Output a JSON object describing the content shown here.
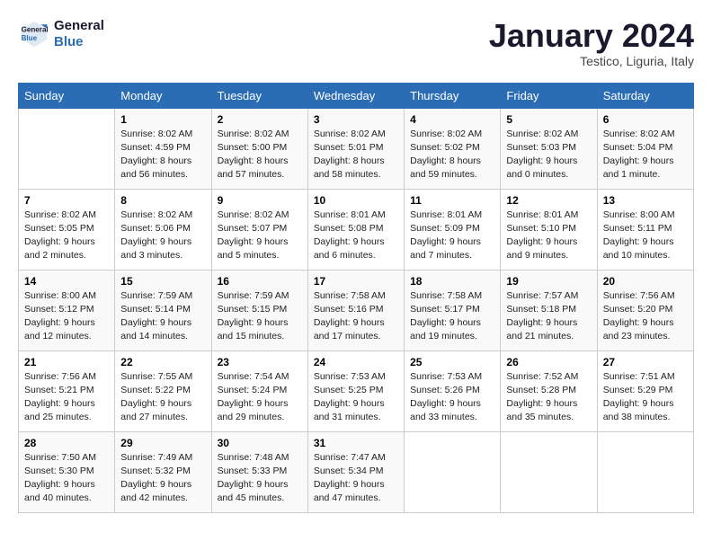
{
  "logo": {
    "line1": "General",
    "line2": "Blue"
  },
  "title": "January 2024",
  "subtitle": "Testico, Liguria, Italy",
  "days_of_week": [
    "Sunday",
    "Monday",
    "Tuesday",
    "Wednesday",
    "Thursday",
    "Friday",
    "Saturday"
  ],
  "weeks": [
    [
      {
        "day": "",
        "info": ""
      },
      {
        "day": "1",
        "info": "Sunrise: 8:02 AM\nSunset: 4:59 PM\nDaylight: 8 hours\nand 56 minutes."
      },
      {
        "day": "2",
        "info": "Sunrise: 8:02 AM\nSunset: 5:00 PM\nDaylight: 8 hours\nand 57 minutes."
      },
      {
        "day": "3",
        "info": "Sunrise: 8:02 AM\nSunset: 5:01 PM\nDaylight: 8 hours\nand 58 minutes."
      },
      {
        "day": "4",
        "info": "Sunrise: 8:02 AM\nSunset: 5:02 PM\nDaylight: 8 hours\nand 59 minutes."
      },
      {
        "day": "5",
        "info": "Sunrise: 8:02 AM\nSunset: 5:03 PM\nDaylight: 9 hours\nand 0 minutes."
      },
      {
        "day": "6",
        "info": "Sunrise: 8:02 AM\nSunset: 5:04 PM\nDaylight: 9 hours\nand 1 minute."
      }
    ],
    [
      {
        "day": "7",
        "info": "Sunrise: 8:02 AM\nSunset: 5:05 PM\nDaylight: 9 hours\nand 2 minutes."
      },
      {
        "day": "8",
        "info": "Sunrise: 8:02 AM\nSunset: 5:06 PM\nDaylight: 9 hours\nand 3 minutes."
      },
      {
        "day": "9",
        "info": "Sunrise: 8:02 AM\nSunset: 5:07 PM\nDaylight: 9 hours\nand 5 minutes."
      },
      {
        "day": "10",
        "info": "Sunrise: 8:01 AM\nSunset: 5:08 PM\nDaylight: 9 hours\nand 6 minutes."
      },
      {
        "day": "11",
        "info": "Sunrise: 8:01 AM\nSunset: 5:09 PM\nDaylight: 9 hours\nand 7 minutes."
      },
      {
        "day": "12",
        "info": "Sunrise: 8:01 AM\nSunset: 5:10 PM\nDaylight: 9 hours\nand 9 minutes."
      },
      {
        "day": "13",
        "info": "Sunrise: 8:00 AM\nSunset: 5:11 PM\nDaylight: 9 hours\nand 10 minutes."
      }
    ],
    [
      {
        "day": "14",
        "info": "Sunrise: 8:00 AM\nSunset: 5:12 PM\nDaylight: 9 hours\nand 12 minutes."
      },
      {
        "day": "15",
        "info": "Sunrise: 7:59 AM\nSunset: 5:14 PM\nDaylight: 9 hours\nand 14 minutes."
      },
      {
        "day": "16",
        "info": "Sunrise: 7:59 AM\nSunset: 5:15 PM\nDaylight: 9 hours\nand 15 minutes."
      },
      {
        "day": "17",
        "info": "Sunrise: 7:58 AM\nSunset: 5:16 PM\nDaylight: 9 hours\nand 17 minutes."
      },
      {
        "day": "18",
        "info": "Sunrise: 7:58 AM\nSunset: 5:17 PM\nDaylight: 9 hours\nand 19 minutes."
      },
      {
        "day": "19",
        "info": "Sunrise: 7:57 AM\nSunset: 5:18 PM\nDaylight: 9 hours\nand 21 minutes."
      },
      {
        "day": "20",
        "info": "Sunrise: 7:56 AM\nSunset: 5:20 PM\nDaylight: 9 hours\nand 23 minutes."
      }
    ],
    [
      {
        "day": "21",
        "info": "Sunrise: 7:56 AM\nSunset: 5:21 PM\nDaylight: 9 hours\nand 25 minutes."
      },
      {
        "day": "22",
        "info": "Sunrise: 7:55 AM\nSunset: 5:22 PM\nDaylight: 9 hours\nand 27 minutes."
      },
      {
        "day": "23",
        "info": "Sunrise: 7:54 AM\nSunset: 5:24 PM\nDaylight: 9 hours\nand 29 minutes."
      },
      {
        "day": "24",
        "info": "Sunrise: 7:53 AM\nSunset: 5:25 PM\nDaylight: 9 hours\nand 31 minutes."
      },
      {
        "day": "25",
        "info": "Sunrise: 7:53 AM\nSunset: 5:26 PM\nDaylight: 9 hours\nand 33 minutes."
      },
      {
        "day": "26",
        "info": "Sunrise: 7:52 AM\nSunset: 5:28 PM\nDaylight: 9 hours\nand 35 minutes."
      },
      {
        "day": "27",
        "info": "Sunrise: 7:51 AM\nSunset: 5:29 PM\nDaylight: 9 hours\nand 38 minutes."
      }
    ],
    [
      {
        "day": "28",
        "info": "Sunrise: 7:50 AM\nSunset: 5:30 PM\nDaylight: 9 hours\nand 40 minutes."
      },
      {
        "day": "29",
        "info": "Sunrise: 7:49 AM\nSunset: 5:32 PM\nDaylight: 9 hours\nand 42 minutes."
      },
      {
        "day": "30",
        "info": "Sunrise: 7:48 AM\nSunset: 5:33 PM\nDaylight: 9 hours\nand 45 minutes."
      },
      {
        "day": "31",
        "info": "Sunrise: 7:47 AM\nSunset: 5:34 PM\nDaylight: 9 hours\nand 47 minutes."
      },
      {
        "day": "",
        "info": ""
      },
      {
        "day": "",
        "info": ""
      },
      {
        "day": "",
        "info": ""
      }
    ]
  ]
}
